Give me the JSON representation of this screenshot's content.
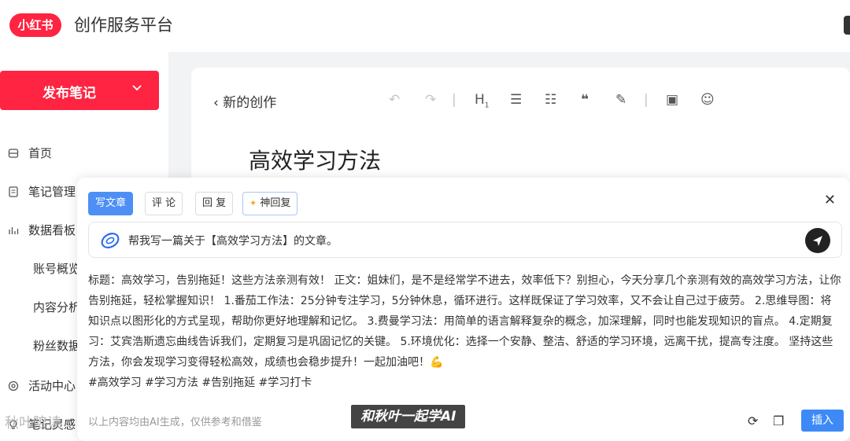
{
  "header": {
    "logo": "小红书",
    "title": "创作服务平台"
  },
  "sidebar": {
    "publish_label": "发布笔记",
    "items": [
      {
        "label": "首页",
        "icon": "home-icon"
      },
      {
        "label": "笔记管理",
        "icon": "note-icon"
      },
      {
        "label": "数据看板",
        "icon": "chart-icon"
      }
    ],
    "subitems": [
      "账号概览",
      "内容分析",
      "粉丝数据"
    ],
    "activity": {
      "label": "活动中心",
      "icon": "activity-icon"
    },
    "more": {
      "label": "笔记灵感",
      "icon": "bulb-icon"
    }
  },
  "editor": {
    "back_label": "新的创作",
    "title": "高效学习方法",
    "toolbar": [
      "undo",
      "redo",
      "heading",
      "ordered-list",
      "unordered-list",
      "quote",
      "highlight",
      "image",
      "emoji"
    ]
  },
  "ai_panel": {
    "tabs": [
      "写文章",
      "评 论",
      "回 复",
      "神回复"
    ],
    "active_tab": "写文章",
    "prompt": "帮我写一篇关于【高效学习方法】的文章。",
    "article": "标题：高效学习，告别拖延！这些方法亲测有效！ 正文：姐妹们，是不是经常学不进去，效率低下？别担心，今天分享几个亲测有效的高效学习方法，让你告别拖延，轻松掌握知识！ 1.番茄工作法：25分钟专注学习，5分钟休息，循环进行。这样既保证了学习效率，又不会让自己过于疲劳。 2.思维导图：将知识点以图形化的方式呈现，帮助你更好地理解和记忆。 3.费曼学习法：用简单的语言解释复杂的概念，加深理解，同时也能发现知识的盲点。 4.定期复习：艾宾浩斯遗忘曲线告诉我们，定期复习是巩固记忆的关键。 5.环境优化：选择一个安静、整洁、舒适的学习环境，远离干扰，提高专注度。 坚持这些方法，你会发现学习变得轻松高效，成绩也会稳步提升！一起加油吧！💪",
    "tags": "#高效学习 #学习方法 #告别拖延 #学习打卡",
    "footer_note": "以上内容均由AI生成，仅供参考和借鉴",
    "watermark": "和秋叶一起学AI",
    "insert_label": "插入",
    "close_label": "✕"
  },
  "overlay_watermark": "秋叶陪读",
  "colors": {
    "brand": "#ff2442",
    "accent": "#3d8af7"
  }
}
